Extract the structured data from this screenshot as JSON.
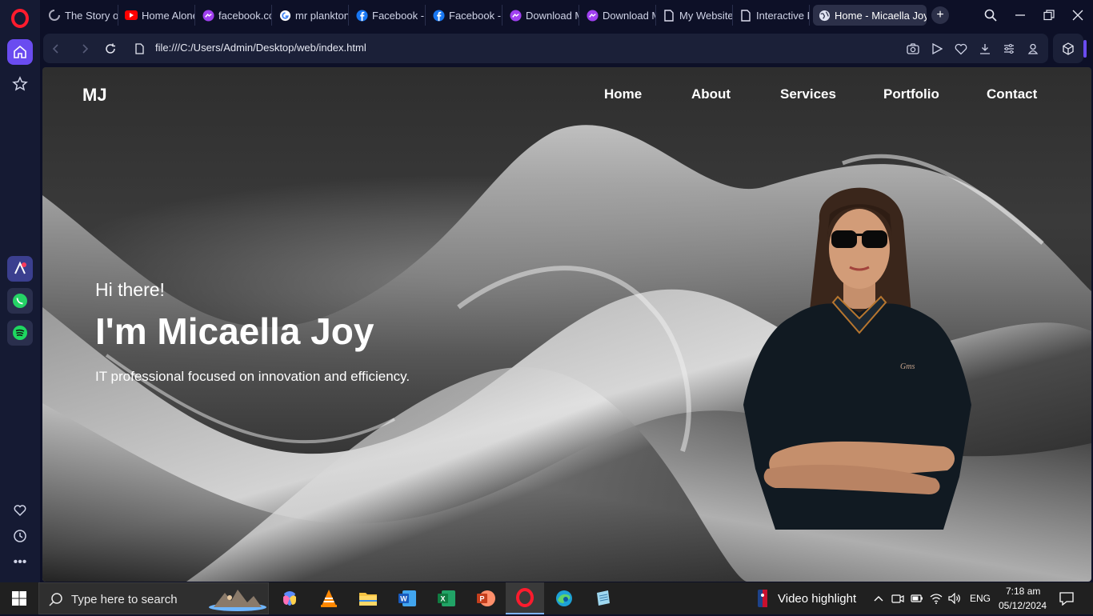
{
  "browser": {
    "tabs": [
      {
        "title": "The Story of",
        "icon": "loading-icon"
      },
      {
        "title": "Home Alone",
        "icon": "youtube-icon"
      },
      {
        "title": "facebook.co",
        "icon": "messenger-icon"
      },
      {
        "title": "mr plankton",
        "icon": "google-icon"
      },
      {
        "title": "Facebook - I",
        "icon": "facebook-icon"
      },
      {
        "title": "Facebook - I",
        "icon": "facebook-icon"
      },
      {
        "title": "Download M",
        "icon": "messenger-icon"
      },
      {
        "title": "Download M",
        "icon": "messenger-icon"
      },
      {
        "title": "My Website",
        "icon": "file-icon"
      },
      {
        "title": "Interactive P",
        "icon": "file-icon"
      },
      {
        "title": "Home - Micaella Joy",
        "icon": "globe-icon",
        "active": true
      }
    ],
    "url": "file:///C:/Users/Admin/Desktop/web/index.html",
    "accent": "#6a4cf0"
  },
  "site": {
    "brand": "MJ",
    "nav": [
      "Home",
      "About",
      "Services",
      "Portfolio",
      "Contact"
    ],
    "hero": {
      "greeting": "Hi there!",
      "name": "I'm Micaella Joy",
      "tagline": "IT professional focused on innovation and efficiency."
    }
  },
  "taskbar": {
    "search_placeholder": "Type here to search",
    "widget_label": "Video highlight",
    "language": "ENG",
    "time": "7:18 am",
    "date": "05/12/2024",
    "apps": [
      "copilot-icon",
      "vlc-icon",
      "file-explorer-icon",
      "word-icon",
      "excel-icon",
      "powerpoint-icon",
      "opera-icon",
      "edge-icon",
      "notepad-icon"
    ]
  }
}
